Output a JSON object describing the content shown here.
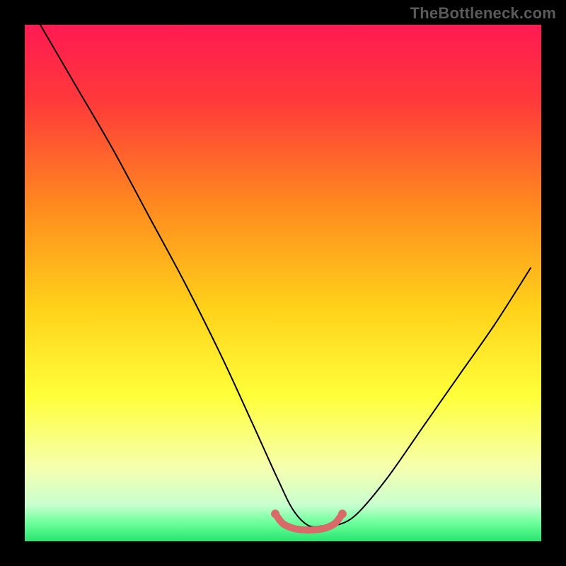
{
  "watermark": "TheBottleneck.com",
  "chart_data": {
    "type": "line",
    "title": "",
    "xlabel": "",
    "ylabel": "",
    "xlim": [
      0,
      100
    ],
    "ylim": [
      0,
      100
    ],
    "background_gradient": {
      "stops": [
        {
          "offset": 0.0,
          "color": "#ff1a52"
        },
        {
          "offset": 0.15,
          "color": "#ff3a3a"
        },
        {
          "offset": 0.35,
          "color": "#ff8a1f"
        },
        {
          "offset": 0.55,
          "color": "#ffd21a"
        },
        {
          "offset": 0.72,
          "color": "#ffff3a"
        },
        {
          "offset": 0.86,
          "color": "#f5ffb0"
        },
        {
          "offset": 0.93,
          "color": "#c8ffcf"
        },
        {
          "offset": 0.965,
          "color": "#6bff9b"
        },
        {
          "offset": 1.0,
          "color": "#28e56f"
        }
      ]
    },
    "series": [
      {
        "name": "bottleneck-curve",
        "color": "#000000",
        "width": 2,
        "x": [
          3,
          10,
          17,
          24,
          31,
          38,
          44,
          49,
          52,
          55,
          58,
          60,
          64,
          70,
          77,
          84,
          91,
          98
        ],
        "y": [
          100,
          88,
          76,
          63,
          50,
          36,
          23,
          12,
          6,
          3,
          3,
          3,
          5,
          12,
          22,
          32,
          42,
          53
        ]
      }
    ],
    "highlight_segment": {
      "name": "optimal-range",
      "color": "#d86a6a",
      "width": 10,
      "x": [
        48.5,
        50,
        52,
        54,
        56,
        58,
        60,
        61.5
      ],
      "y": [
        5.3,
        3.4,
        2.5,
        2.2,
        2.2,
        2.5,
        3.4,
        5.3
      ],
      "endpoints": [
        {
          "x": 48.5,
          "y": 5.3
        },
        {
          "x": 61.5,
          "y": 5.3
        }
      ]
    }
  }
}
